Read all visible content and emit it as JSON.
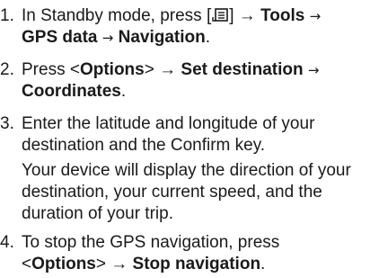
{
  "steps": [
    {
      "number": "1.",
      "line1": {
        "pre": "In Standby mode, press [",
        "post": "] →",
        "tools": "Tools",
        "arrow": "→"
      },
      "line2": {
        "gps": "GPS data",
        "arrow": "→",
        "nav": "Navigation",
        "end": "."
      },
      "menu_key_icon": "menu-key-icon"
    },
    {
      "number": "2.",
      "line1": {
        "pre": "Press <",
        "options": "Options",
        "post": "> →",
        "setdest": "Set destination",
        "arrow": "→"
      },
      "line2": {
        "coords": "Coordinates",
        "end": "."
      }
    },
    {
      "number": "3.",
      "line1": "Enter the latitude and longitude of your",
      "line2": "destination and the Confirm key."
    },
    {
      "note_line1": "Your device will display the direction of your",
      "note_line2": "destination, your current speed, and the",
      "note_line3": "duration of your trip."
    },
    {
      "number": "4.",
      "line1": "To stop the GPS navigation, press",
      "line2": {
        "pre": "<",
        "options": "Options",
        "post": "> →",
        "stop": "Stop navigation",
        "end": "."
      }
    }
  ]
}
